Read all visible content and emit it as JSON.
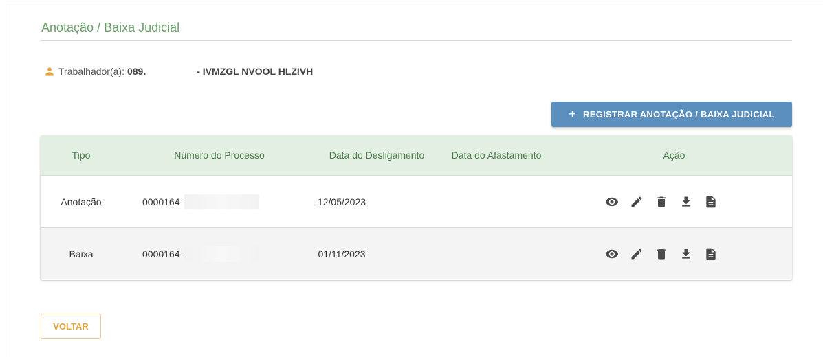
{
  "page": {
    "title": "Anotação / Baixa Judicial"
  },
  "worker": {
    "label": "Trabalhador(a):",
    "cpf_prefix": "089.",
    "name": "- IVMZGL NVOOL HLZIVH",
    "icon": "person-icon"
  },
  "toolbar": {
    "add_icon": "plus-icon",
    "add_label": "REGISTRAR ANOTAÇÃO / BAIXA JUDICIAL"
  },
  "table": {
    "headers": [
      "Tipo",
      "Número do Processo",
      "Data do Desligamento",
      "Data do Afastamento",
      "Ação"
    ],
    "rows": [
      {
        "tipo": "Anotação",
        "processo": "0000164-",
        "data_desligamento": "12/05/2023",
        "data_afastamento": ""
      },
      {
        "tipo": "Baixa",
        "processo": "0000164-",
        "data_desligamento": "01/11/2023",
        "data_afastamento": ""
      }
    ],
    "action_icons": [
      "view-icon",
      "edit-icon",
      "delete-icon",
      "download-icon",
      "document-icon"
    ]
  },
  "footer": {
    "back_label": "VOLTAR"
  },
  "colors": {
    "title": "#6a9e6a",
    "header_bg": "#e3efe3",
    "header_text": "#4b7e4b",
    "primary_button": "#5b8fbd",
    "back_button_text": "#e3a33e",
    "person_icon": "#e3a33e"
  }
}
